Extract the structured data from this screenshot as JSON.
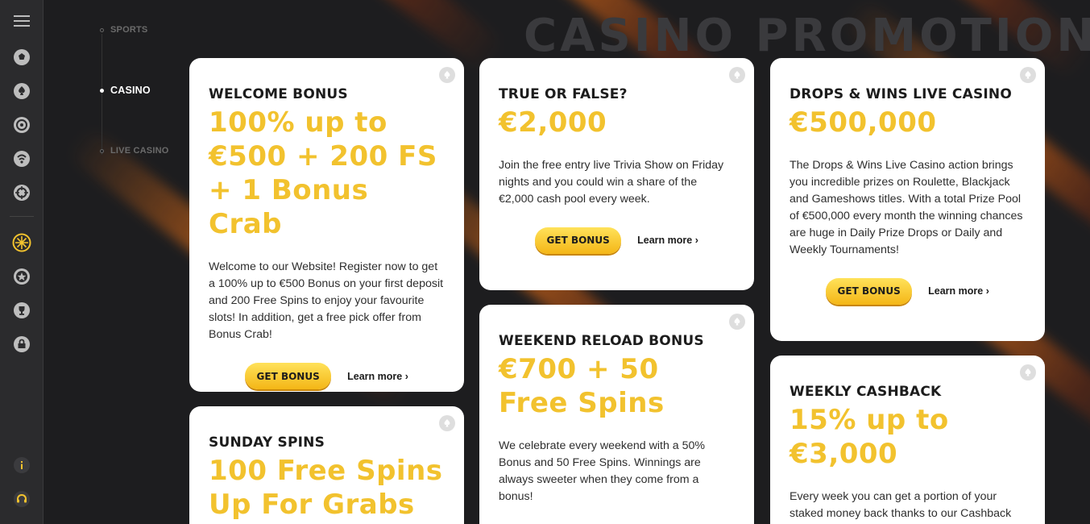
{
  "page": {
    "hero_title": "CASINO PROMOTIONS"
  },
  "subnav": [
    {
      "label": "SPORTS",
      "active": false
    },
    {
      "label": "CASINO",
      "active": true
    },
    {
      "label": "LIVE CASINO",
      "active": false
    }
  ],
  "rail_icons": [
    "menu-icon",
    "soccer-ball-icon",
    "spade-icon",
    "roulette-icon",
    "live-broadcast-icon",
    "esports-icon",
    "promotions-icon",
    "star-badge-icon",
    "trophy-icon",
    "shop-icon",
    "info-icon",
    "support-headset-icon"
  ],
  "colors": {
    "accent_yellow": "#f2c22e",
    "background": "#1d1d1f",
    "card": "#ffffff",
    "rail": "#2b2b2d"
  },
  "cards": [
    {
      "title": "WELCOME BONUS",
      "amount": "100% up to €500 + 200 FS + 1 Bonus Crab",
      "desc": "Welcome to our Website! Register now to get a 100% up to €500 Bonus on your first deposit and 200 Free Spins to enjoy your favourite slots! In addition, get a free pick offer from Bonus Crab!",
      "button": "GET BONUS",
      "learn": "Learn more ›"
    },
    {
      "title": "TRUE OR FALSE?",
      "amount": "€2,000",
      "desc": "Join the free entry live Trivia Show on Friday nights and you could win a share of the €2,000 cash pool every week.",
      "button": "GET BONUS",
      "learn": "Learn more ›"
    },
    {
      "title": "DROPS & WINS LIVE CASINO",
      "amount": "€500,000",
      "desc": "The Drops & Wins Live Casino action brings you incredible prizes on Roulette, Blackjack and Gameshows titles. With a total Prize Pool of €500,000 every month the winning chances are huge in Daily Prize Drops or Daily and Weekly Tournaments!",
      "button": "GET BONUS",
      "learn": "Learn more ›"
    },
    {
      "title": "SUNDAY SPINS",
      "amount": "100 Free Spins Up For Grabs"
    },
    {
      "title": "WEEKEND RELOAD BONUS",
      "amount": "€700 + 50 Free Spins",
      "desc": "We celebrate every weekend with a 50% Bonus and 50 Free Spins. Winnings are always sweeter when they come from a bonus!"
    },
    {
      "title": "WEEKLY CASHBACK",
      "amount": "15% up to €3,000",
      "desc": "Every week you can get a portion of your staked money back thanks to our Cashback Bonus. Receive yours!"
    }
  ]
}
